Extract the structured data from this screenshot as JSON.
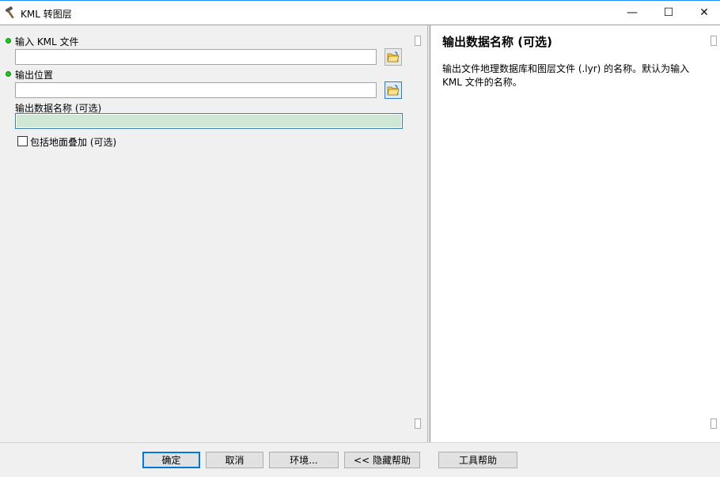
{
  "window": {
    "title": "KML 转图层",
    "minimize": "—",
    "maximize": "☐",
    "close": "✕"
  },
  "params": {
    "input_kml": {
      "label": "输入 KML 文件",
      "value": ""
    },
    "output_location": {
      "label": "输出位置",
      "value": ""
    },
    "output_name": {
      "label": "输出数据名称 (可选)",
      "value": ""
    },
    "include_ground": {
      "label": "包括地面叠加 (可选)",
      "checked": false
    }
  },
  "help": {
    "title": "输出数据名称 (可选)",
    "body": "输出文件地理数据库和图层文件 (.lyr) 的名称。默认为输入 KML 文件的名称。"
  },
  "buttons": {
    "ok": "确定",
    "cancel": "取消",
    "environments": "环境...",
    "hide_help": "<< 隐藏帮助",
    "tool_help": "工具帮助"
  },
  "colors": {
    "required_dot": "#1ec81e",
    "active_field": "#cfe8d6",
    "focus_border": "#0078d7"
  }
}
